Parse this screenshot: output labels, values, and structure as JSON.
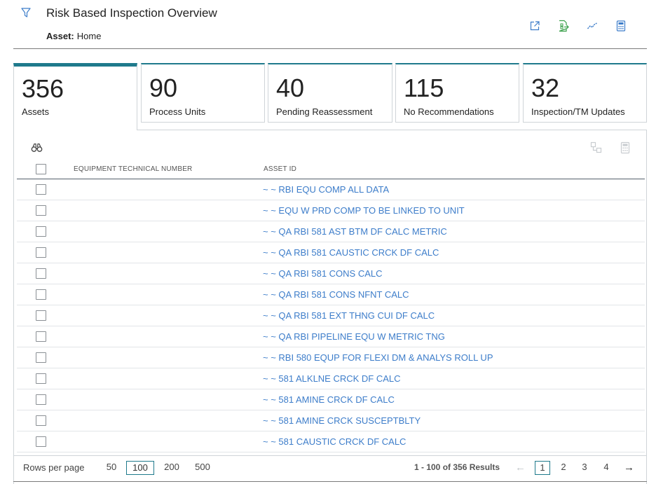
{
  "header": {
    "title": "Risk Based Inspection Overview",
    "asset_label": "Asset:",
    "asset_value": "Home",
    "actions": [
      "open-in-new-icon",
      "export-icon",
      "trend-icon",
      "calculator-icon"
    ]
  },
  "tabs": [
    {
      "count": "356",
      "label": "Assets",
      "active": true
    },
    {
      "count": "90",
      "label": "Process Units",
      "active": false
    },
    {
      "count": "40",
      "label": "Pending Reassessment",
      "active": false
    },
    {
      "count": "115",
      "label": "No Recommendations",
      "active": false
    },
    {
      "count": "32",
      "label": "Inspection/TM Updates",
      "active": false
    }
  ],
  "grid": {
    "columns": [
      "EQUIPMENT TECHNICAL NUMBER",
      "ASSET ID"
    ],
    "rows": [
      {
        "equipment": "",
        "asset_id": "~ ~ RBI EQU COMP ALL DATA"
      },
      {
        "equipment": "",
        "asset_id": "~ ~ EQU W PRD COMP TO BE LINKED TO UNIT"
      },
      {
        "equipment": "",
        "asset_id": "~ ~ QA RBI 581 AST BTM DF CALC METRIC"
      },
      {
        "equipment": "",
        "asset_id": "~ ~ QA RBI 581 CAUSTIC CRCK DF CALC"
      },
      {
        "equipment": "",
        "asset_id": "~ ~ QA RBI 581 CONS CALC"
      },
      {
        "equipment": "",
        "asset_id": "~ ~ QA RBI 581 CONS NFNT CALC"
      },
      {
        "equipment": "",
        "asset_id": "~ ~ QA RBI 581 EXT THNG CUI DF CALC"
      },
      {
        "equipment": "",
        "asset_id": "~ ~ QA RBI PIPELINE EQU W METRIC TNG"
      },
      {
        "equipment": "",
        "asset_id": "~ ~ RBI 580 EQUP FOR FLEXI DM & ANALYS ROLL UP"
      },
      {
        "equipment": "",
        "asset_id": "~ ~ 581 ALKLNE CRCK DF CALC"
      },
      {
        "equipment": "",
        "asset_id": "~ ~ 581 AMINE CRCK DF CALC"
      },
      {
        "equipment": "",
        "asset_id": "~ ~ 581 AMINE CRCK SUSCEPTBLTY"
      },
      {
        "equipment": "",
        "asset_id": "~ ~ 581 CAUSTIC CRCK DF CALC"
      }
    ]
  },
  "footer": {
    "rows_per_page_label": "Rows per page",
    "rows_per_page_options": [
      "50",
      "100",
      "200",
      "500"
    ],
    "rows_per_page_selected": "100",
    "results_text": "1 - 100 of 356 Results",
    "pages": [
      "1",
      "2",
      "3",
      "4"
    ],
    "current_page": "1"
  },
  "colors": {
    "accent": "#1f7a8c",
    "link": "#3d7dca",
    "icon": "#3d7dca",
    "export_icon": "#3aa04a"
  }
}
